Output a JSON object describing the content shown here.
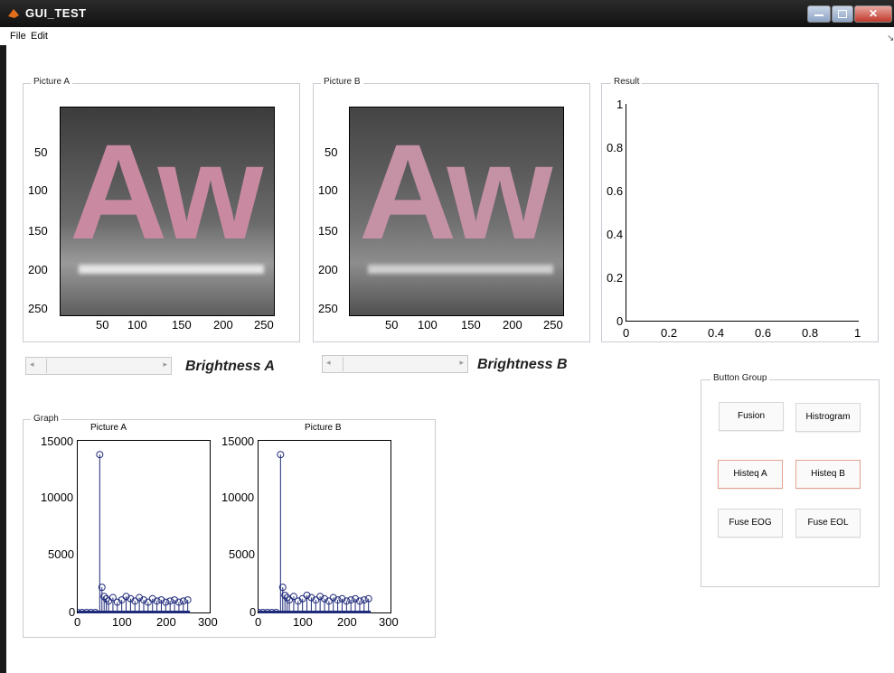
{
  "window": {
    "title": "GUI_TEST"
  },
  "menu": {
    "file": "File",
    "edit": "Edit"
  },
  "panels": {
    "picture_a": "Picture A",
    "picture_b": "Picture B",
    "result": "Result",
    "graph": "Graph",
    "button_group": "Button Group"
  },
  "image_axes": {
    "y_ticks": [
      "50",
      "100",
      "150",
      "200",
      "250"
    ],
    "x_ticks": [
      "50",
      "100",
      "150",
      "200",
      "250"
    ],
    "letters": "Aw"
  },
  "result_axes": {
    "y_ticks": [
      "0",
      "0.2",
      "0.4",
      "0.6",
      "0.8",
      "1"
    ],
    "x_ticks": [
      "0",
      "0.2",
      "0.4",
      "0.6",
      "0.8",
      "1"
    ]
  },
  "brightness": {
    "a": "Brightness  A",
    "b": "Brightness  B"
  },
  "graph": {
    "titles": [
      "Picture A",
      "Picture B"
    ],
    "y_ticks": [
      "0",
      "5000",
      "10000",
      "15000"
    ],
    "x_ticks": [
      "0",
      "100",
      "200",
      "300"
    ]
  },
  "buttons": {
    "fusion": "Fusion",
    "histrogram": "Histrogram",
    "histeq_a": "Histeq A",
    "histeq_b": "Histeq B",
    "fuse_eog": "Fuse EOG",
    "fuse_eol": "Fuse EOL"
  },
  "chart_data": [
    {
      "type": "scatter",
      "title": "Picture A",
      "xlim": [
        0,
        300
      ],
      "ylim": [
        0,
        15000
      ],
      "x": [
        0,
        10,
        20,
        30,
        40,
        50,
        55,
        60,
        65,
        70,
        80,
        90,
        100,
        110,
        120,
        130,
        140,
        150,
        160,
        170,
        180,
        190,
        200,
        210,
        220,
        230,
        240,
        250
      ],
      "values": [
        0,
        0,
        0,
        0,
        0,
        13800,
        2200,
        1400,
        1200,
        1000,
        1300,
        900,
        1100,
        1400,
        1200,
        1000,
        1300,
        1100,
        900,
        1200,
        1000,
        1100,
        900,
        1000,
        1100,
        900,
        1000,
        1100
      ]
    },
    {
      "type": "scatter",
      "title": "Picture B",
      "xlim": [
        0,
        300
      ],
      "ylim": [
        0,
        15000
      ],
      "x": [
        0,
        10,
        20,
        30,
        40,
        50,
        55,
        60,
        65,
        70,
        80,
        90,
        100,
        110,
        120,
        130,
        140,
        150,
        160,
        170,
        180,
        190,
        200,
        210,
        220,
        230,
        240,
        250
      ],
      "values": [
        0,
        0,
        0,
        0,
        0,
        13800,
        2200,
        1500,
        1300,
        1100,
        1400,
        1000,
        1200,
        1500,
        1300,
        1100,
        1400,
        1200,
        1000,
        1300,
        1100,
        1200,
        1000,
        1100,
        1200,
        1000,
        1100,
        1200
      ]
    }
  ]
}
